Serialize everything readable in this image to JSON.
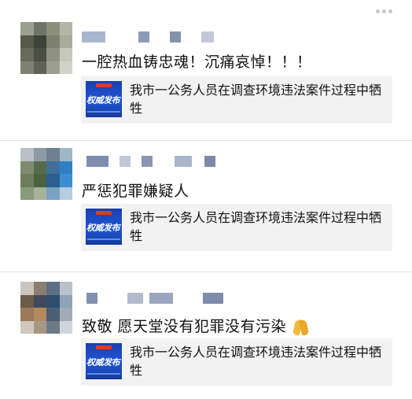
{
  "posts": [
    {
      "comment": "一腔热血铸忠魂！沉痛哀悼！！！",
      "card_source": "权威发布",
      "card_title": "我市一公务人员在调查环境违法案件过程中牺牲",
      "emoji": ""
    },
    {
      "comment": "严惩犯罪嫌疑人",
      "card_source": "权威发布",
      "card_title": "我市一公务人员在调查环境违法案件过程中牺牲",
      "emoji": ""
    },
    {
      "comment": "致敬 愿天堂没有犯罪没有污染",
      "card_source": "权威发布",
      "card_title": "我市一公务人员在调查环境违法案件过程中牺牲",
      "emoji": "folded-hands"
    }
  ],
  "colors": {
    "card_bg": "#f2f2f2",
    "text": "#111111",
    "thumb_blue": "#1f56d6",
    "thumb_badge": "#d93a2b",
    "emoji_gold": "#f2b93b"
  }
}
